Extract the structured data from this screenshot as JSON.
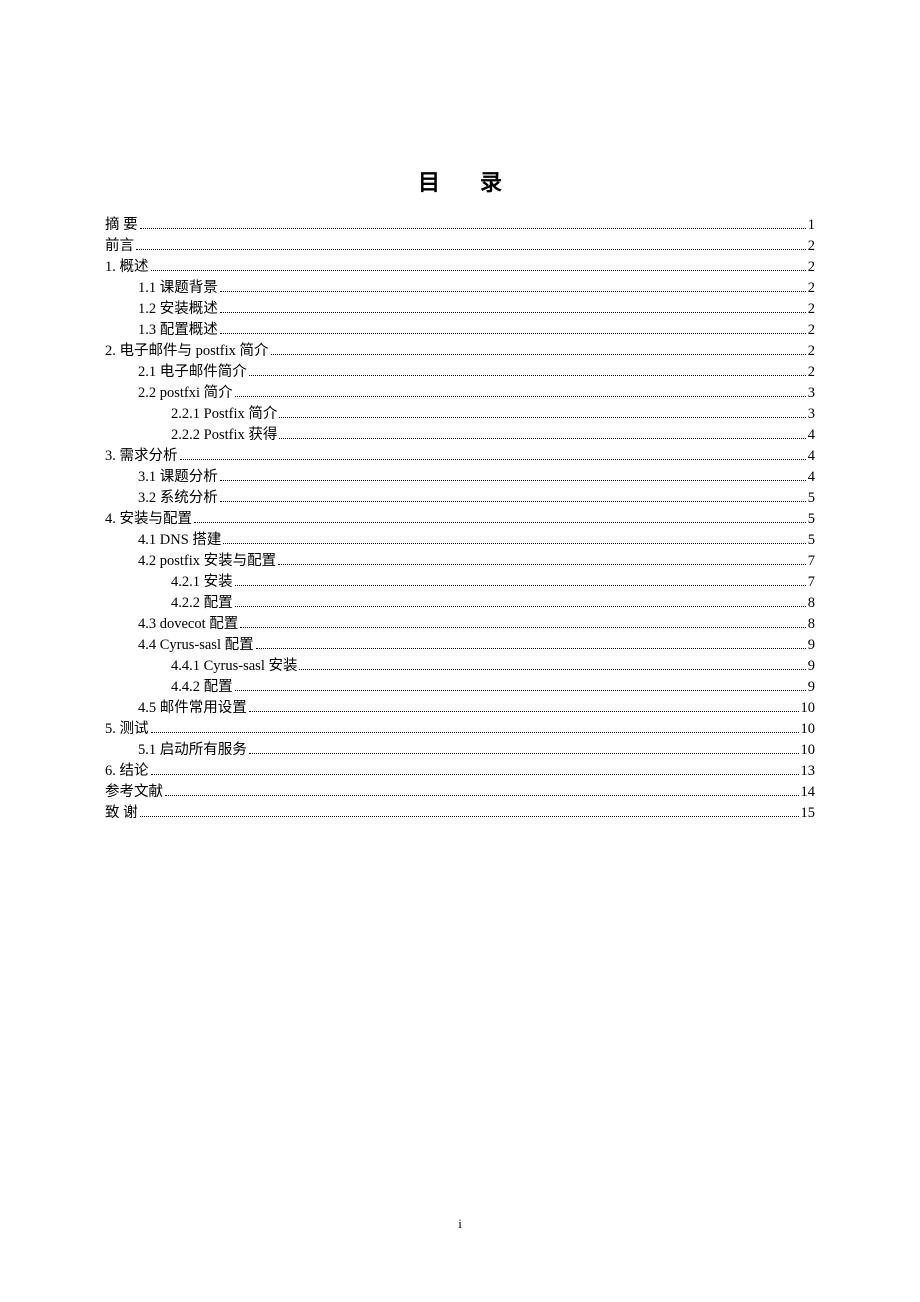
{
  "title": "目录",
  "footer": "i",
  "entries": [
    {
      "label": "摘  要",
      "page": "1",
      "indent": 0
    },
    {
      "label": "前言",
      "page": "2",
      "indent": 0
    },
    {
      "label": "1. 概述",
      "page": "2",
      "indent": 0
    },
    {
      "label": "1.1 课题背景",
      "page": "2",
      "indent": 1
    },
    {
      "label": "1.2 安装概述",
      "page": "2",
      "indent": 1
    },
    {
      "label": "1.3 配置概述",
      "page": "2",
      "indent": 1
    },
    {
      "label": "2. 电子邮件与 postfix 简介",
      "page": "2",
      "indent": 0
    },
    {
      "label": "2.1 电子邮件简介",
      "page": "2",
      "indent": 1
    },
    {
      "label": "2.2 postfxi 简介",
      "page": "3",
      "indent": 1
    },
    {
      "label": "2.2.1 Postfix 简介",
      "page": "3",
      "indent": 2
    },
    {
      "label": "2.2.2 Postfix 获得",
      "page": "4",
      "indent": 2
    },
    {
      "label": "3. 需求分析",
      "page": "4",
      "indent": 0
    },
    {
      "label": "3.1 课题分析",
      "page": "4",
      "indent": 1
    },
    {
      "label": "3.2 系统分析",
      "page": "5",
      "indent": 1
    },
    {
      "label": "4. 安装与配置",
      "page": "5",
      "indent": 0
    },
    {
      "label": "4.1 DNS 搭建",
      "page": "5",
      "indent": 1
    },
    {
      "label": "4.2 postfix 安装与配置",
      "page": "7",
      "indent": 1
    },
    {
      "label": "4.2.1 安装",
      "page": "7",
      "indent": 2
    },
    {
      "label": "4.2.2 配置",
      "page": "8",
      "indent": 2
    },
    {
      "label": "4.3 dovecot 配置",
      "page": "8",
      "indent": 1
    },
    {
      "label": "4.4 Cyrus-sasl 配置",
      "page": "9",
      "indent": 1
    },
    {
      "label": "4.4.1 Cyrus-sasl 安装",
      "page": "9",
      "indent": 2
    },
    {
      "label": "4.4.2 配置",
      "page": "9",
      "indent": 2
    },
    {
      "label": "4.5 邮件常用设置",
      "page": "10",
      "indent": 1
    },
    {
      "label": "5. 测试",
      "page": "10",
      "indent": 0
    },
    {
      "label": "5.1 启动所有服务",
      "page": "10",
      "indent": 1
    },
    {
      "label": "6. 结论",
      "page": "13",
      "indent": 0
    },
    {
      "label": "参考文献",
      "page": "14",
      "indent": 0
    },
    {
      "label": "致      谢",
      "page": "15",
      "indent": 0
    }
  ]
}
